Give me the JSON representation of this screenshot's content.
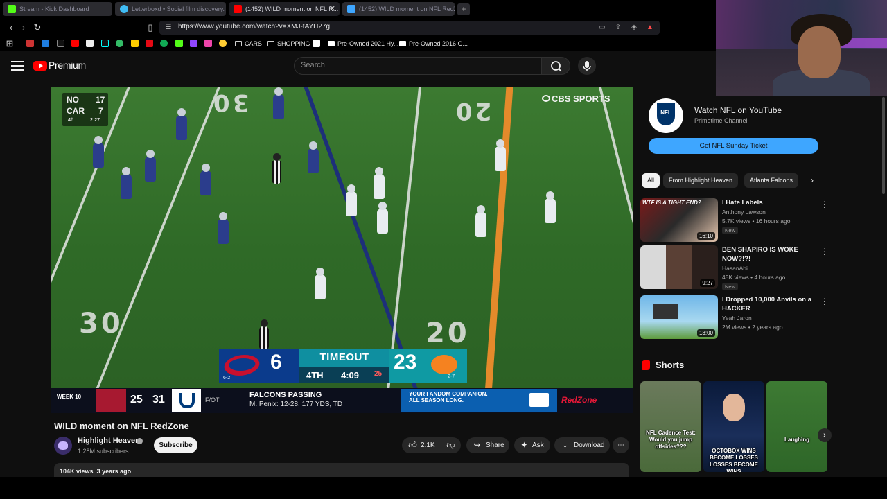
{
  "browser": {
    "tabs": [
      {
        "title": "Stream - Kick Dashboard",
        "color": "#53fc18",
        "active": false
      },
      {
        "title": "Letterboxd • Social film discovery.",
        "color": "#40bcf4",
        "active": false
      },
      {
        "title": "(1452) WILD moment on NFL R...",
        "color": "#ff0000",
        "active": true
      },
      {
        "title": "(1452) WILD moment on NFL RedZo...",
        "color": "#3ea6ff",
        "active": false
      }
    ],
    "url": "https://www.youtube.com/watch?v=XMJ-tAYH27g",
    "bookmarks": [
      {
        "label": "CARS",
        "kind": "folder"
      },
      {
        "label": "SHOPPING",
        "kind": "folder"
      },
      {
        "label": "Pre-Owned 2021 Hy...",
        "kind": "page"
      },
      {
        "label": "Pre-Owned 2016 G...",
        "kind": "page"
      }
    ]
  },
  "youtube": {
    "brand": "Premium",
    "search_placeholder": "Search"
  },
  "video": {
    "title": "WILD moment on NFL RedZone",
    "broadcaster": "CBS SPORTS",
    "minibox": {
      "team1": "NO",
      "score1": "17",
      "team2": "CAR",
      "score2": "7",
      "qtr": "4ᵗʰ",
      "clock": "2:27"
    },
    "scorebug": {
      "away_score": "6",
      "home_score": "23",
      "status": "TIMEOUT",
      "quarter": "4TH",
      "clock": "4:09",
      "play_clock": "25",
      "away_record": "6-2",
      "home_record": "2-7"
    },
    "ticker": {
      "week": "WEEK 10",
      "falcons_score": "25",
      "colts_score": "31",
      "final": "F/OT",
      "headline": "FALCONS PASSING",
      "detail": "M. Penix: 12-28, 177 YDS, TD",
      "ad_line1": "YOUR FANDOM COMPANION.",
      "ad_line2": "ALL SEASON LONG.",
      "network": "RedZone"
    },
    "yard_numbers": [
      "30",
      "20",
      "30",
      "20"
    ]
  },
  "channel": {
    "name": "Highlight Heaven",
    "subscribers": "1.28M subscribers",
    "subscribe_label": "Subscribe"
  },
  "actions": {
    "likes": "2.1K",
    "share": "Share",
    "ask": "Ask",
    "download": "Download"
  },
  "description": {
    "views": "104K views",
    "age": "3 years ago"
  },
  "sidebar": {
    "promo": {
      "logo_text": "NFL",
      "title": "Watch NFL on YouTube",
      "subtitle": "Primetime Channel",
      "button": "Get NFL Sunday Ticket"
    },
    "chips": [
      "All",
      "From Highlight Heaven",
      "Atlanta Falcons"
    ],
    "recommendations": [
      {
        "title": "I Hate Labels",
        "channel": "Anthony Lawson",
        "meta": "5.7K views • 16 hours ago",
        "badge": "New",
        "duration": "16:10",
        "thumb_text": "WTF IS A TIGHT END?"
      },
      {
        "title": "BEN SHAPIRO IS WOKE NOW?!?!",
        "channel": "HasanAbi",
        "meta": "45K views • 4 hours ago",
        "badge": "New",
        "duration": "9:27"
      },
      {
        "title": "I Dropped 10,000 Anvils on a HACKER",
        "channel": "Yeah Jaron",
        "meta": "2M views • 2 years ago",
        "badge": "",
        "duration": "13:00"
      }
    ],
    "shorts_title": "Shorts",
    "shorts": [
      {
        "caption": "NFL Cadence Test: Would you jump offsides???"
      },
      {
        "caption": "OCTOBOX WINS BECOME LOSSES LOSSES BECOME WINS"
      },
      {
        "caption": "Laughing"
      }
    ]
  }
}
